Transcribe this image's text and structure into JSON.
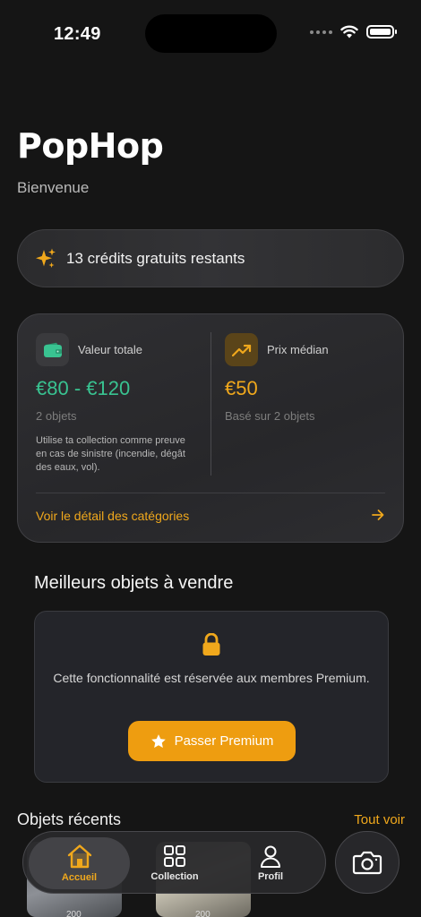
{
  "status_bar": {
    "time": "12:49"
  },
  "header": {
    "app_name": "PopHop",
    "welcome": "Bienvenue"
  },
  "credits": {
    "icon": "sparkles-icon",
    "text": "13 crédits gratuits restants",
    "accent": "#f0a81c"
  },
  "stats": {
    "total_value": {
      "icon": "wallet-icon",
      "label": "Valeur totale",
      "value": "€80 - €120",
      "sub": "2 objets",
      "note": "Utilise ta collection comme preuve en cas de sinistre (incendie, dégât des eaux, vol).",
      "color": "#39c391"
    },
    "median_price": {
      "icon": "trending-up-icon",
      "label": "Prix médian",
      "value": "€50",
      "sub": "Basé sur 2 objets",
      "color": "#f0a81c"
    },
    "detail_link": "Voir le détail des catégories"
  },
  "best_objects": {
    "title": "Meilleurs objets à vendre",
    "lock_icon": "lock-icon",
    "message": "Cette fonctionnalité est réservée aux membres Premium.",
    "button_label": "Passer Premium"
  },
  "recent": {
    "title": "Objets récents",
    "see_all": "Tout voir",
    "items": [
      {
        "caption": "200"
      },
      {
        "caption": "200"
      }
    ]
  },
  "nav": {
    "items": [
      {
        "label": "Accueil",
        "icon": "home-icon",
        "active": true
      },
      {
        "label": "Collection",
        "icon": "grid-icon",
        "active": false
      },
      {
        "label": "Profil",
        "icon": "user-icon",
        "active": false
      }
    ],
    "camera_icon": "camera-icon"
  },
  "colors": {
    "background": "#151515",
    "accent": "#f0a81c",
    "green": "#39c391",
    "premium_button": "#ee9d10"
  }
}
